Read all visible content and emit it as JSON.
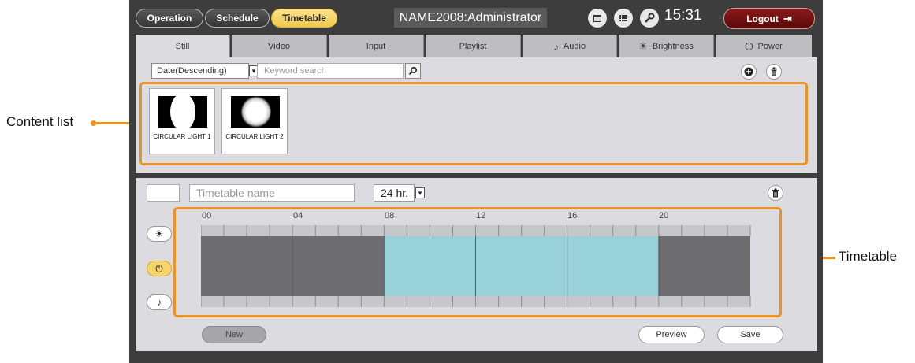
{
  "callouts": {
    "content_list": "Content list",
    "timetable": "Timetable"
  },
  "nav": {
    "operation": "Operation",
    "schedule": "Schedule",
    "timetable": "Timetable",
    "user": "NAME2008:Administrator",
    "time": "15:31",
    "logout": "Logout"
  },
  "tabs": [
    {
      "label": "Still",
      "icon": ""
    },
    {
      "label": "Video",
      "icon": ""
    },
    {
      "label": "Input",
      "icon": ""
    },
    {
      "label": "Playlist",
      "icon": ""
    },
    {
      "label": "Audio",
      "icon": "music-note-icon"
    },
    {
      "label": "Brightness",
      "icon": "sun-icon"
    },
    {
      "label": "Power",
      "icon": "power-icon"
    }
  ],
  "content": {
    "sort_value": "Date(Descending)",
    "search_placeholder": "Keyword search",
    "items": [
      {
        "caption": "CIRCULAR LIGHT 1"
      },
      {
        "caption": "CIRCULAR LIGHT 2"
      }
    ]
  },
  "timetable": {
    "name_placeholder": "Timetable name",
    "format": "24 hr.",
    "hour_labels": [
      "00",
      "04",
      "08",
      "12",
      "16",
      "20"
    ],
    "cyan_segment_hours": [
      8,
      20
    ],
    "colors": {
      "dark": "#6e6e70",
      "cyan": "#98d2d8"
    }
  },
  "buttons": {
    "new": "New",
    "preview": "Preview",
    "save": "Save"
  },
  "colors": {
    "accent": "#f0921e",
    "active_tab": "#f6d46a"
  }
}
